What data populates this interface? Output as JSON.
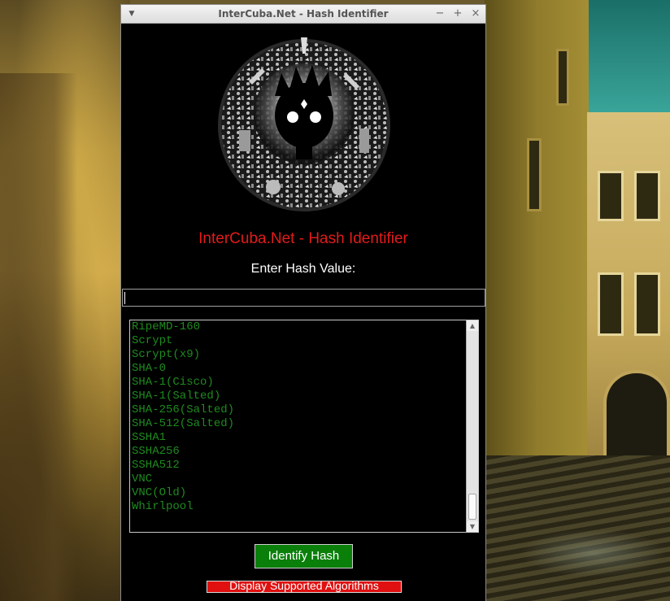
{
  "window": {
    "title": "InterCuba.Net - Hash Identifier",
    "controls": {
      "minimize": "−",
      "maximize": "+",
      "close": "×",
      "menu": "▼"
    }
  },
  "app": {
    "heading": "InterCuba.Net - Hash Identifier",
    "hash_label": "Enter Hash Value:",
    "hash_input_value": ""
  },
  "algorithms": [
    "RipeMD-160",
    "Scrypt",
    "Scrypt(x9)",
    "SHA-0",
    "SHA-1(Cisco)",
    "SHA-1(Salted)",
    "SHA-256(Salted)",
    "SHA-512(Salted)",
    "SSHA1",
    "SSHA256",
    "SSHA512",
    "VNC",
    "VNC(Old)",
    "Whirlpool"
  ],
  "buttons": {
    "identify": "Identify Hash",
    "supported": "Display Supported Algorithms"
  },
  "colors": {
    "heading": "#e21b1b",
    "list_text": "#1f8a1f",
    "identify_button": "#0a7f0a",
    "supported_button": "#e01010"
  }
}
